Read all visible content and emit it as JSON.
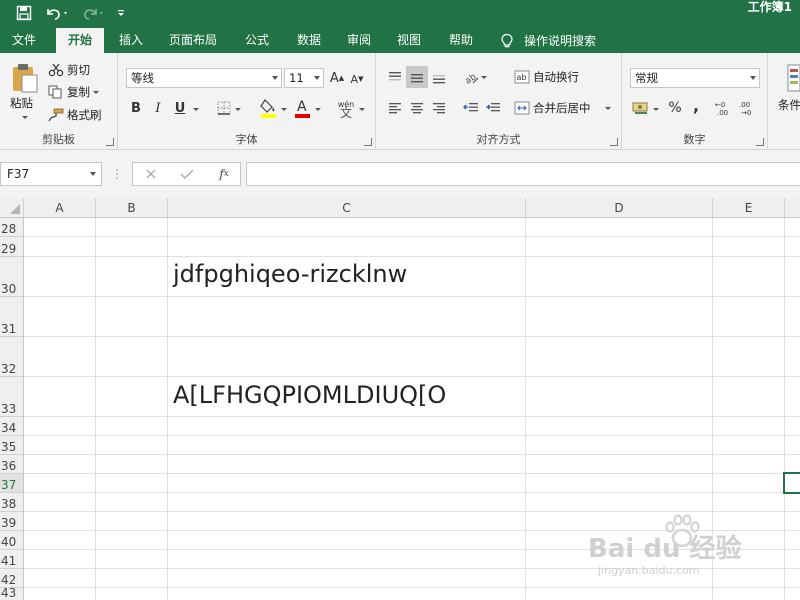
{
  "titlebar": {
    "title": "工作簿1"
  },
  "tabs": [
    {
      "label": "文件"
    },
    {
      "label": "开始"
    },
    {
      "label": "插入"
    },
    {
      "label": "页面布局"
    },
    {
      "label": "公式"
    },
    {
      "label": "数据"
    },
    {
      "label": "审阅"
    },
    {
      "label": "视图"
    },
    {
      "label": "帮助"
    }
  ],
  "tellme": {
    "label": "操作说明搜索"
  },
  "ribbon": {
    "clipboard": {
      "paste": "粘贴",
      "cut": "剪切",
      "copy": "复制",
      "format_painter": "格式刷",
      "label": "剪贴板"
    },
    "font": {
      "name": "等线",
      "size": "11",
      "bold": "B",
      "italic": "I",
      "underline": "U",
      "label": "字体"
    },
    "alignment": {
      "wrap": "自动换行",
      "merge": "合并后居中",
      "label": "对齐方式"
    },
    "number": {
      "format": "常规",
      "percent": "%",
      "comma": ",",
      "label": "数字"
    },
    "styles": {
      "conditional": "条件"
    }
  },
  "formula_bar": {
    "name_box": "F37",
    "formula": ""
  },
  "columns": [
    "A",
    "B",
    "C",
    "D",
    "E"
  ],
  "rows": [
    "28",
    "29",
    "30",
    "31",
    "32",
    "33",
    "34",
    "35",
    "36",
    "37",
    "38",
    "39",
    "40",
    "41",
    "42",
    "43"
  ],
  "cells": {
    "c30": "jdfpghiqeo-rizcklnw",
    "c33": "A[LFHGQPIOMLDIUQ[O"
  },
  "selection": {
    "row": "37"
  },
  "watermark": {
    "text": "Bai du 经验",
    "sub": "jingyan.baidu.com"
  },
  "colors": {
    "accent": "#217346"
  }
}
